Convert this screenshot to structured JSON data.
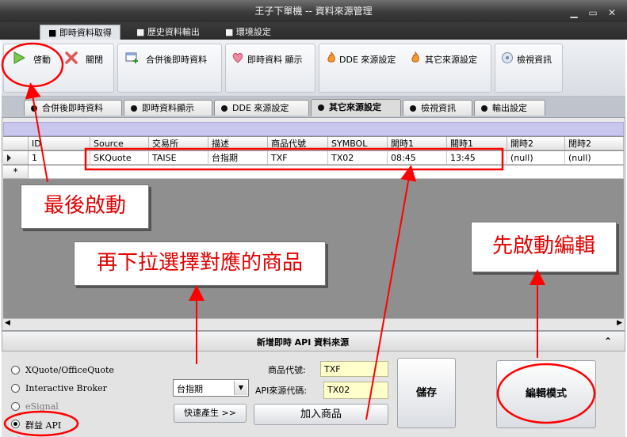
{
  "window": {
    "title": "王子下單機 -- 資料來源管理"
  },
  "top_tabs": [
    {
      "label": "即時資料取得"
    },
    {
      "label": "歷史資料輸出"
    },
    {
      "label": "環境設定"
    }
  ],
  "toolbar": {
    "start_label": "啓動",
    "close_label": "關閉",
    "merged_label": "合併後即時資料",
    "realtime_display_label": "即時資料 顯示",
    "dde_label": "DDE 來源設定",
    "other_label": "其它來源設定",
    "inspect_label": "檢視資訊"
  },
  "sub_tabs": [
    {
      "label": "合併後即時資料"
    },
    {
      "label": "即時資料顯示"
    },
    {
      "label": "DDE 來源設定"
    },
    {
      "label": "其它來源設定"
    },
    {
      "label": "檢視資訊"
    },
    {
      "label": "輸出設定"
    }
  ],
  "grid": {
    "columns": [
      "ID",
      "Source",
      "交易所",
      "描述",
      "商品代號",
      "SYMBOL",
      "開時1",
      "關時1",
      "開時2",
      "閉時2"
    ],
    "rows": [
      [
        "1",
        "SKQuote",
        "TAISE",
        "台指期",
        "TXF",
        "TX02",
        "08:45",
        "13:45",
        "(null)",
        "(null)"
      ]
    ],
    "new_row_marker": "*"
  },
  "bottom": {
    "title": "新增即時 API 資料來源",
    "collapse_icon": "double-chevron-up-icon",
    "sources": [
      {
        "label": "XQuote/OfficeQuote",
        "selected": false
      },
      {
        "label": "Interactive Broker",
        "selected": false
      },
      {
        "label": "eSignal",
        "selected": false,
        "disabled": true
      },
      {
        "label": "群益 API",
        "selected": true
      }
    ],
    "product_select_value": "台指期",
    "quick_generate_label": "快速產生 >>",
    "product_code_label": "商品代號:",
    "product_code_value": "TXF",
    "api_code_label": "API來源代碼:",
    "api_code_value": "TX02",
    "add_product_label": "加入商品",
    "save_label": "儲存",
    "edit_mode_label": "編輯模式"
  },
  "annotations": {
    "last_start": "最後啟動",
    "pick_product": "再下拉選擇對應的商品",
    "start_edit": "先啟動編輯",
    "color": "#ff0000"
  }
}
